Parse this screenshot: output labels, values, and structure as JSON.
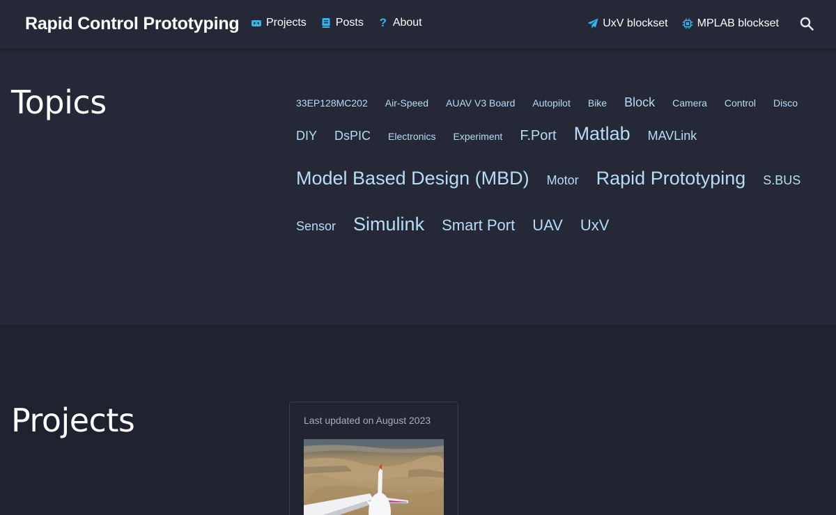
{
  "navbar": {
    "brand": "Rapid Control Prototyping",
    "left_links": [
      {
        "label": "Projects",
        "icon": "projects-icon"
      },
      {
        "label": "Posts",
        "icon": "book-icon"
      },
      {
        "label": "About",
        "icon": "question-icon",
        "glyph": "?"
      }
    ],
    "right_links": [
      {
        "label": "UxV blockset",
        "icon": "paper-plane-icon"
      },
      {
        "label": "MPLAB blockset",
        "icon": "chip-icon"
      }
    ],
    "search_icon": "search-icon"
  },
  "topics": {
    "title": "Topics",
    "tags": [
      "33EP128MC202",
      "Air-Speed",
      "AUAV V3 Board",
      "Autopilot",
      "Bike",
      "Block",
      "Camera",
      "Control",
      "Disco",
      "DIY",
      "DsPIC",
      "Electronics",
      "Experiment",
      "F.Port",
      "Matlab",
      "MAVLink",
      "Model Based Design (MBD)",
      "Motor",
      "Rapid Prototyping",
      "S.BUS",
      "Sensor",
      "Simulink",
      "Smart Port",
      "UAV",
      "UxV"
    ]
  },
  "projects": {
    "title": "Projects",
    "cards": [
      {
        "meta": "Last updated on August 2023",
        "image": "rc-plane-on-sand"
      }
    ]
  },
  "colors": {
    "background": "#1f222e",
    "navbar": "#252836",
    "accent": "#35b6e8",
    "tag": "#b7dcf5"
  }
}
